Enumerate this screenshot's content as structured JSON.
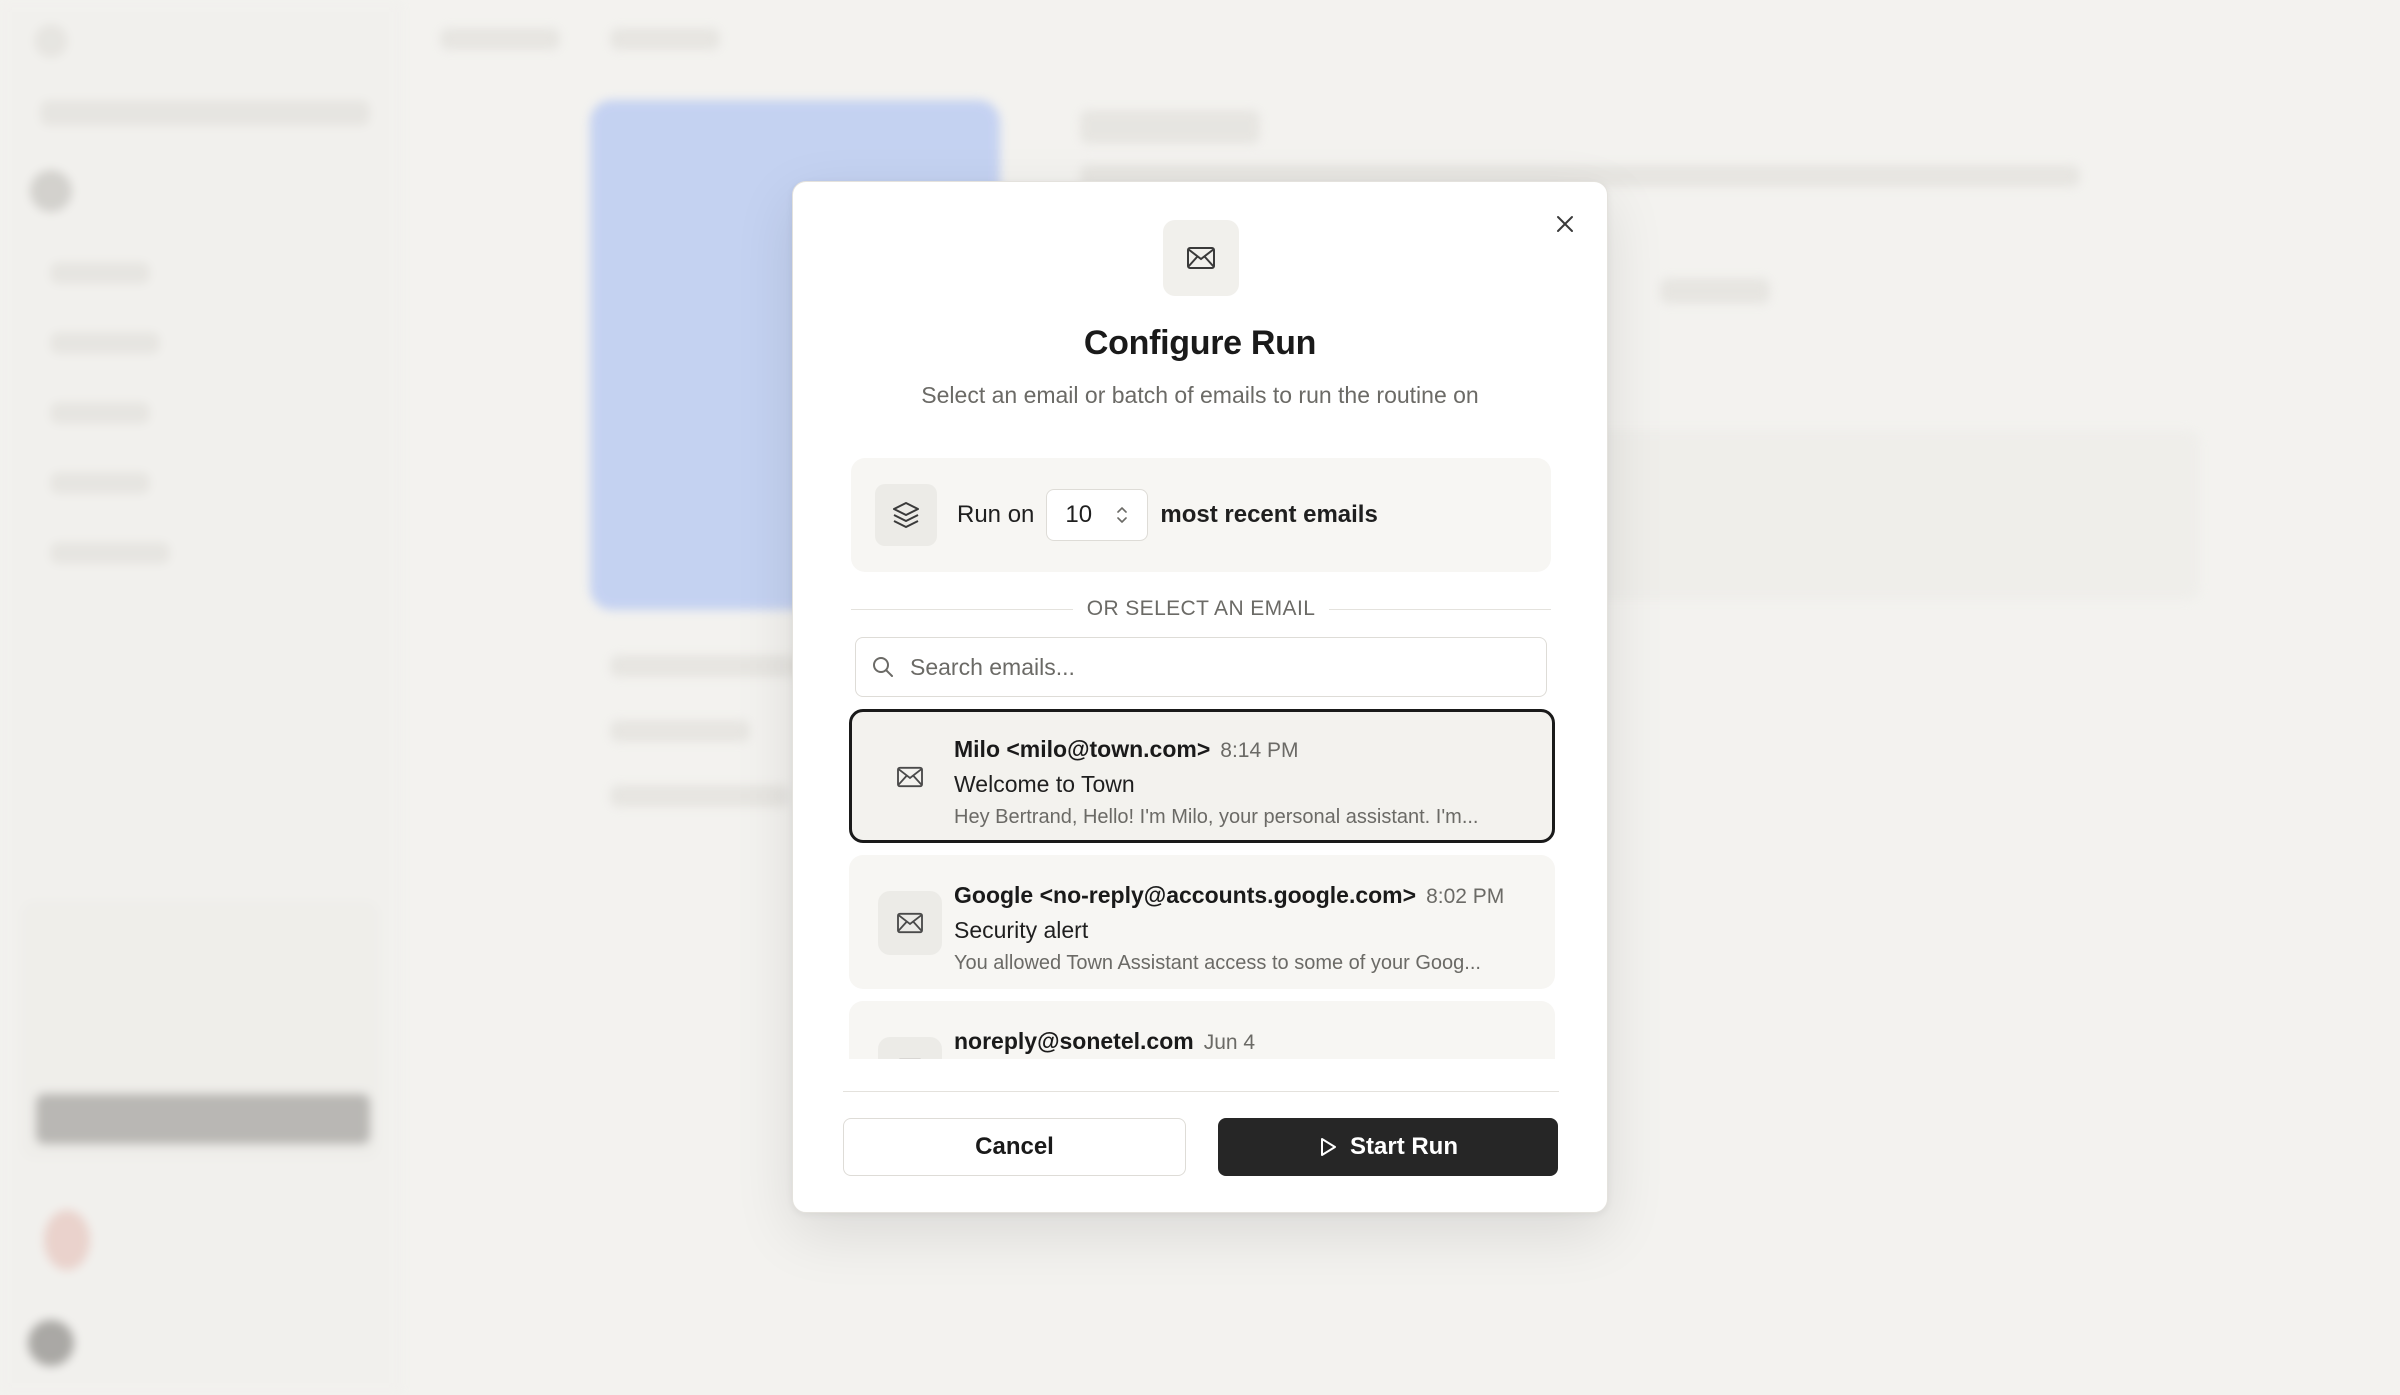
{
  "modal": {
    "title": "Configure Run",
    "subtitle": "Select an email or batch of emails to run the routine on",
    "header_icon": "mail-icon",
    "close_icon": "close-icon"
  },
  "batch": {
    "icon": "layers-icon",
    "prefix": "Run on",
    "count": "10",
    "suffix": "most recent emails"
  },
  "divider": {
    "label": "OR SELECT AN EMAIL"
  },
  "search": {
    "placeholder": "Search emails...",
    "value": ""
  },
  "emails": [
    {
      "sender": "Milo <milo@town.com>",
      "time": "8:14 PM",
      "subject": "Welcome to Town",
      "preview": "Hey Bertrand, Hello! I'm Milo, your personal assistant. I'm...",
      "selected": true
    },
    {
      "sender": "Google <no-reply@accounts.google.com>",
      "time": "8:02 PM",
      "subject": "Security alert",
      "preview": "You allowed Town Assistant access to some of your Goog...",
      "selected": false
    },
    {
      "sender": "noreply@sonetel.com",
      "time": "Jun 4",
      "subject": "",
      "preview": "",
      "selected": false
    }
  ],
  "footer": {
    "cancel_label": "Cancel",
    "start_label": "Start Run",
    "start_icon": "play-icon"
  }
}
